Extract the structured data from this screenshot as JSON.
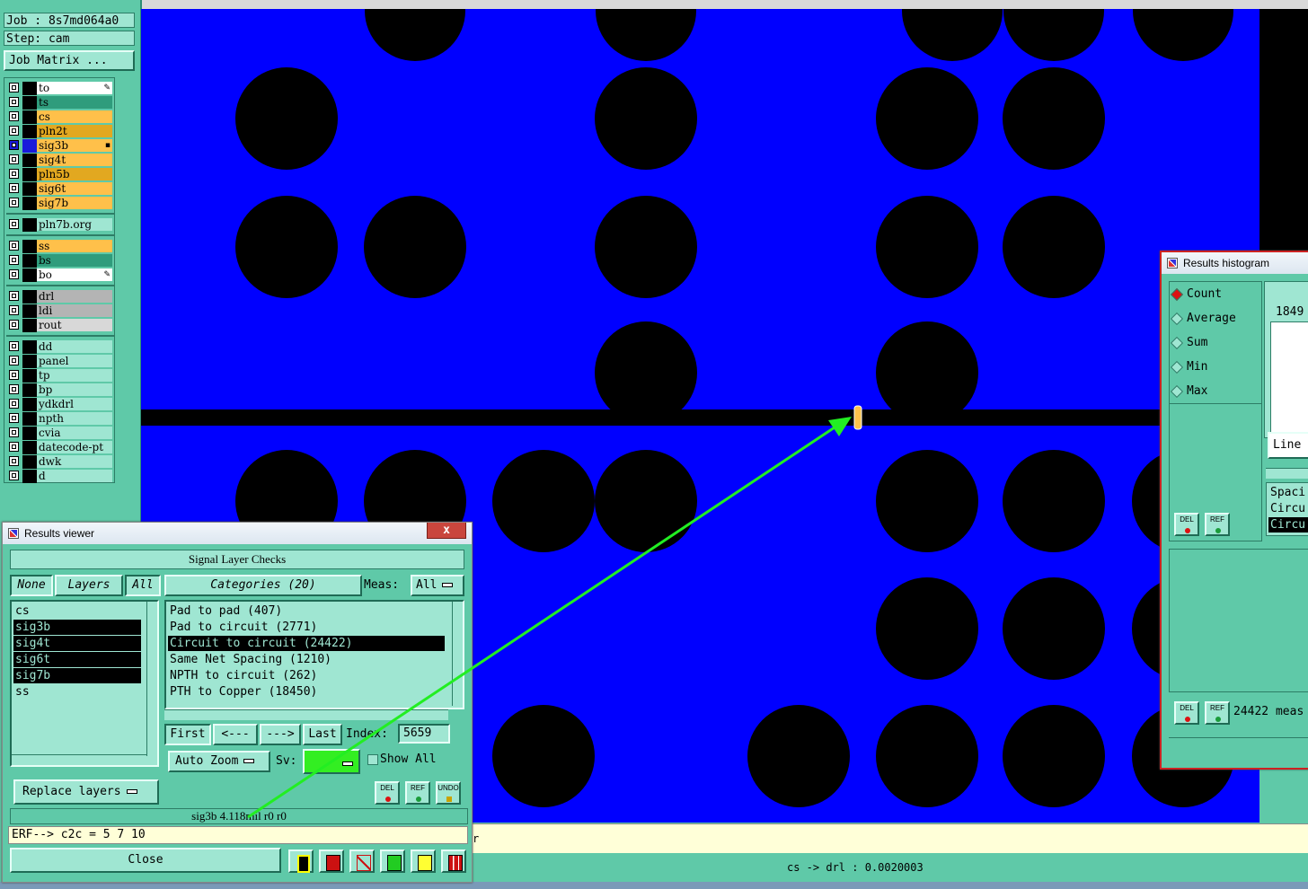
{
  "job": {
    "job_label": "Job : 8s7md064a0",
    "step_label": "Step: cam",
    "matrix_button": "Job Matrix ..."
  },
  "layers": [
    {
      "name": "to",
      "color": "#ffffff",
      "mark": "pencil"
    },
    {
      "name": "ts",
      "color": "#2f9c7c"
    },
    {
      "name": "cs",
      "color": "#ffc04a"
    },
    {
      "name": "pln2t",
      "color": "#e2a820"
    },
    {
      "name": "sig3b",
      "color": "#ffc04a",
      "active": true
    },
    {
      "name": "sig4t",
      "color": "#ffc04a"
    },
    {
      "name": "pln5b",
      "color": "#e2a820"
    },
    {
      "name": "sig6t",
      "color": "#ffc04a"
    },
    {
      "name": "sig7b",
      "color": "#ffc04a"
    },
    {
      "name": "pln7b.org",
      "color": "#9fe6d2"
    },
    {
      "name": "ss",
      "color": "#ffc04a"
    },
    {
      "name": "bs",
      "color": "#2f9c7c"
    },
    {
      "name": "bo",
      "color": "#ffffff",
      "mark": "pencil"
    },
    {
      "name": "drl",
      "color": "#b4b4b4"
    },
    {
      "name": "ldi",
      "color": "#b4b4b4"
    },
    {
      "name": "rout",
      "color": "#d8d8d8"
    },
    {
      "name": "dd",
      "color": "#9fe6d2"
    },
    {
      "name": "panel",
      "color": "#9fe6d2"
    },
    {
      "name": "tp",
      "color": "#9fe6d2"
    },
    {
      "name": "bp",
      "color": "#9fe6d2"
    },
    {
      "name": "ydkdrl",
      "color": "#9fe6d2"
    },
    {
      "name": "npth",
      "color": "#9fe6d2"
    },
    {
      "name": "cvia",
      "color": "#9fe6d2"
    },
    {
      "name": "datecode-pt",
      "color": "#9fe6d2"
    },
    {
      "name": "dwk",
      "color": "#9fe6d2"
    },
    {
      "name": "d",
      "color": "#9fe6d2"
    }
  ],
  "viewer": {
    "title": "Results viewer",
    "close_x": "x",
    "section_title": "Signal Layer Checks",
    "none_btn": "None",
    "layers_btn": "Layers",
    "all_btn": "All",
    "categories_btn": "Categories (20)",
    "meas_label": "Meas:",
    "meas_value": "All",
    "layer_items": [
      {
        "name": "cs",
        "selected": false
      },
      {
        "name": "sig3b",
        "selected": true
      },
      {
        "name": "sig4t",
        "selected": true
      },
      {
        "name": "sig6t",
        "selected": true
      },
      {
        "name": "sig7b",
        "selected": true
      },
      {
        "name": "ss",
        "selected": false
      }
    ],
    "categories": [
      {
        "text": "Pad to pad (407)",
        "selected": false
      },
      {
        "text": "Pad to circuit (2771)",
        "selected": false
      },
      {
        "text": "Circuit to circuit (24422)",
        "selected": true
      },
      {
        "text": "Same Net Spacing (1210)",
        "selected": false
      },
      {
        "text": "NPTH to circuit (262)",
        "selected": false
      },
      {
        "text": "PTH to Copper (18450)",
        "selected": false
      }
    ],
    "first_btn": "First",
    "prev_btn": "<---",
    "next_btn": "--->",
    "last_btn": "Last",
    "index_label": "Index:",
    "index_value": "5659",
    "zoom_btn": "Auto Zoom",
    "sv_label": "Sv:",
    "sv_color": "#33ee22",
    "show_all": "Show All",
    "replace_btn": "Replace layers",
    "del_label": "DEL",
    "ref_label": "REF",
    "undo_label": "UNDO",
    "result_line": "sig3b 4.118mil  r0  r0",
    "erf_line": "ERF--> c2c = 5 7 10",
    "close_btn": "Close"
  },
  "histogram": {
    "title": "Results histogram",
    "options": [
      {
        "label": "Count",
        "selected": true
      },
      {
        "label": "Average",
        "selected": false
      },
      {
        "label": "Sum",
        "selected": false
      },
      {
        "label": "Min",
        "selected": false
      },
      {
        "label": "Max",
        "selected": false
      }
    ],
    "value_top": "1849",
    "line_btn": "Line",
    "list_items": [
      {
        "text": "Spaci",
        "selected": false
      },
      {
        "text": "Circu",
        "selected": false
      },
      {
        "text": "Circu",
        "selected": true
      }
    ],
    "del_label": "DEL",
    "ref_label": "REF",
    "meas_text": "24422 meas"
  },
  "status": {
    "line1_suffix": "r",
    "line2": "cs -> drl : 0.0020003"
  },
  "colors": {
    "canvas": "#0000ff",
    "copper": "#000000",
    "ui": "#5fc9a8",
    "marker": "#ffc24a",
    "arrow": "#22ee22"
  }
}
